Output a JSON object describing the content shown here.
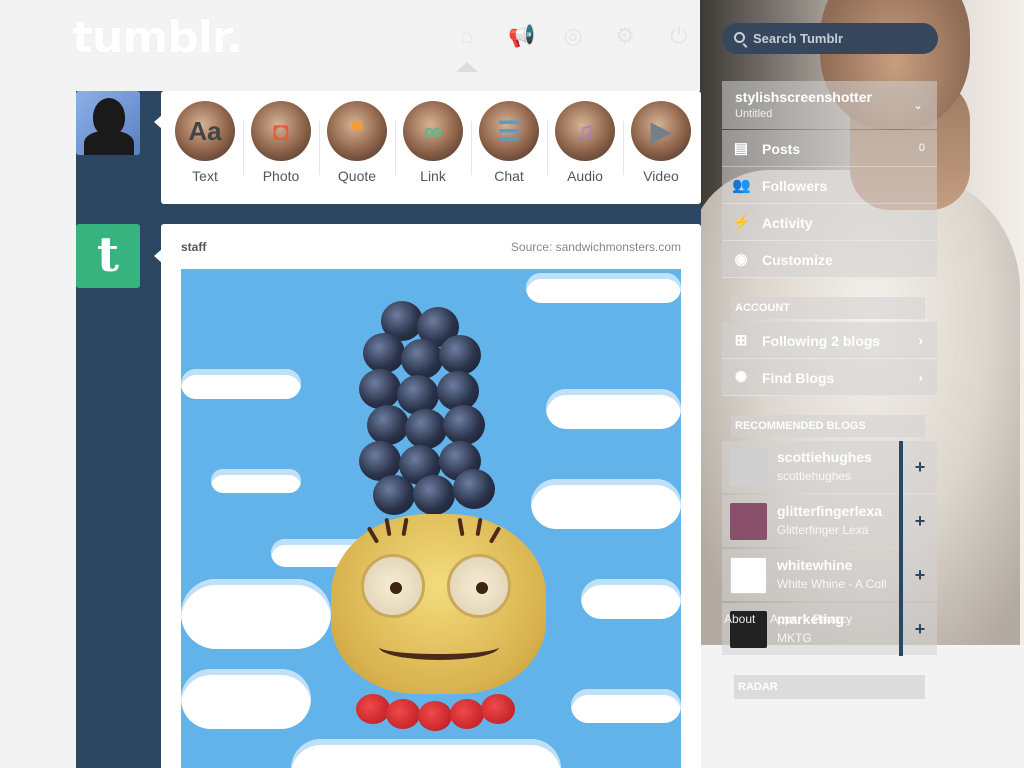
{
  "header": {
    "logo": "tumblr.",
    "nav": [
      {
        "icon": "home-icon",
        "glyph": "⌂"
      },
      {
        "icon": "megaphone-icon",
        "glyph": "📢"
      },
      {
        "icon": "compass-icon",
        "glyph": "◎"
      },
      {
        "icon": "gear-icon",
        "glyph": "⚙"
      },
      {
        "icon": "power-icon",
        "glyph": "⏻"
      }
    ],
    "search_placeholder": "Search Tumblr"
  },
  "post_types": [
    {
      "label": "Text",
      "glyph": "Aa",
      "color": "#444"
    },
    {
      "label": "Photo",
      "glyph": "◘",
      "color": "#e55a3c"
    },
    {
      "label": "Quote",
      "glyph": "❝",
      "color": "#f39c36"
    },
    {
      "label": "Link",
      "glyph": "∞",
      "color": "#56bc8a"
    },
    {
      "label": "Chat",
      "glyph": "☰",
      "color": "#529ecc"
    },
    {
      "label": "Audio",
      "glyph": "♫",
      "color": "#a77dc2"
    },
    {
      "label": "Video",
      "glyph": "▶",
      "color": "#748089"
    }
  ],
  "post": {
    "author": "staff",
    "source": "Source: sandwichmonsters.com"
  },
  "sidebar": {
    "blog_name": "stylishscreenshotter",
    "blog_sub": "Untitled",
    "blog_items": [
      {
        "label": "Posts",
        "count": "0",
        "icon": "posts-icon",
        "glyph": "▤"
      },
      {
        "label": "Followers",
        "count": "",
        "icon": "followers-icon",
        "glyph": "👥"
      },
      {
        "label": "Activity",
        "count": "",
        "icon": "activity-icon",
        "glyph": "⚡"
      },
      {
        "label": "Customize",
        "count": "",
        "icon": "eye-icon",
        "glyph": "◉"
      }
    ],
    "account_label": "ACCOUNT",
    "account_items": [
      {
        "label": "Following 2 blogs",
        "icon": "following-icon",
        "glyph": "⊞"
      },
      {
        "label": "Find Blogs",
        "icon": "find-blogs-icon",
        "glyph": "✺"
      }
    ],
    "recommended_label": "RECOMMENDED BLOGS",
    "recommended": [
      {
        "name": "scottiehughes",
        "desc": "scottiehughes",
        "thumb": "#cfcfcf"
      },
      {
        "name": "glitterfingerlexa",
        "desc": "Glitterfinger Lexa",
        "thumb": "#8a4f6b"
      },
      {
        "name": "whitewhine",
        "desc": "White Whine - A Coll",
        "thumb": "#ffffff"
      },
      {
        "name": "marketing",
        "desc": "MKTG",
        "thumb": "#222222"
      }
    ],
    "footer_links": [
      "About",
      "Apps",
      "Privacy"
    ],
    "radar_label": "RADAR"
  }
}
